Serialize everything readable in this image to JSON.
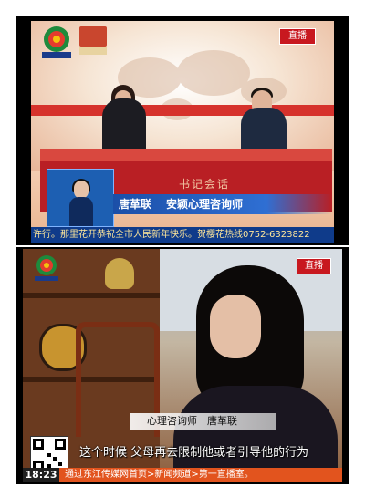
{
  "top_panel": {
    "live_badge": "直播",
    "lower_third": {
      "name": "唐革联",
      "title": "安颖心理咨询师"
    },
    "desk_text": "书记会话",
    "ticker": "许行。那里花开恭祝全市人民新年快乐。贺樱花热线0752-6323822"
  },
  "bottom_panel": {
    "live_badge": "直播",
    "name_bar": "心理咨询师　唐革联",
    "subtitle": "这个时候 父母再去限制他或者引导他的行为",
    "clock": "18:23",
    "ticker": "通过东江传媒网首页>新闻频道>第一直播室。"
  },
  "colors": {
    "live_red": "#c8181f",
    "broadcast_blue": "#1b4fa8",
    "ticker_orange": "#e2541e"
  }
}
